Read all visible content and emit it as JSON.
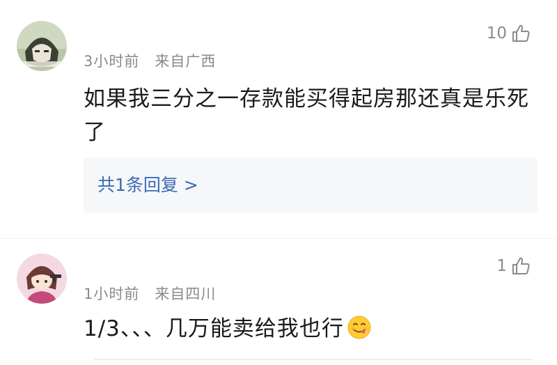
{
  "comments": [
    {
      "time": "3小时前",
      "location": "来自广西",
      "likes": "10",
      "text": "如果我三分之一存款能买得起房那还真是乐死了",
      "replies_link": "共1条回复 >"
    },
    {
      "time": "1小时前",
      "location": "来自四川",
      "likes": "1",
      "text": "1/3、、、几万能卖给我也行"
    }
  ],
  "icons": {
    "like": "thumb-up-outline-icon",
    "emoji": "savoring-face-emoji"
  },
  "colors": {
    "meta_text": "#8a8a8a",
    "link": "#3a6bb4",
    "reply_bg": "#f6f7f9"
  }
}
